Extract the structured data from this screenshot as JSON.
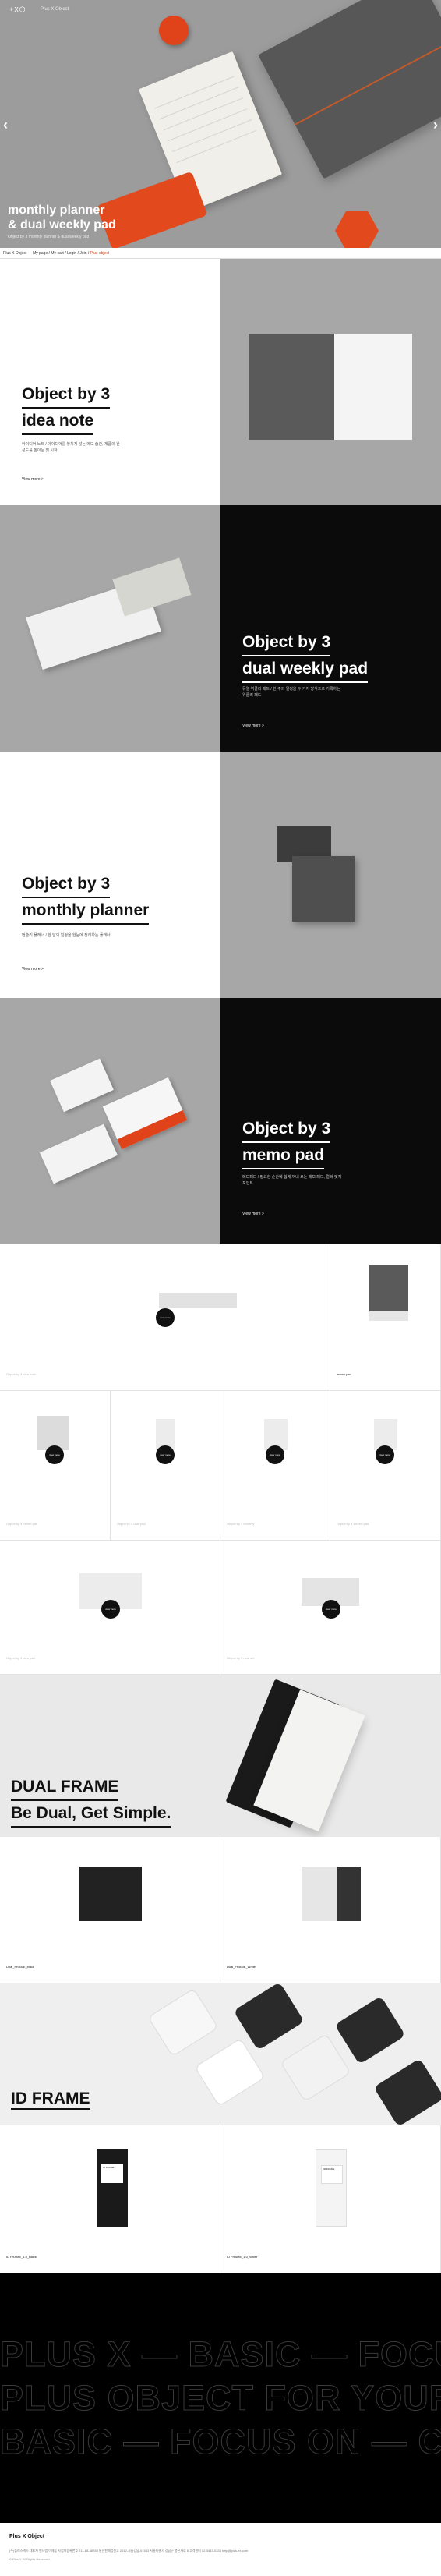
{
  "header": {
    "logo": "+X⬡",
    "brand": "Plus X Object",
    "hero_title_1": "monthly planner",
    "hero_title_2": "& dual weekly pad",
    "hero_sub": "Object by 3 monthly planner & dual weekly pad",
    "prev_arrow": "‹",
    "next_arrow": "›"
  },
  "breadcrumb": {
    "text": "Plus X Object — My page / My cart / Login / Join /",
    "highlight": "Plus object"
  },
  "products": [
    {
      "title_1": "Object by 3",
      "title_2": "idea note",
      "desc": "아이디어 노트 / 아이디어를 놓치지 않는 메모 습관, 제품의 완성도를 높이는 첫 시작",
      "more": "View more  >"
    },
    {
      "title_1": "Object by 3",
      "title_2": "dual weekly pad",
      "desc": "듀얼 위클리 패드 / 한 주의 일정을 두 가지 방식으로 기록하는 위클리 패드",
      "more": "View more  >"
    },
    {
      "title_1": "Object by 3",
      "title_2": "monthly planner",
      "desc": "먼슬리 플래너 / 한 달의 일정을 한눈에 정리하는 플래너",
      "more": "View more  >"
    },
    {
      "title_1": "Object by 3",
      "title_2": "memo pad",
      "desc": "메모패드 / 필요한 순간에 쉽게 꺼내 쓰는 메모 패드, 컬러 엣지 포인트",
      "more": "View more  >"
    }
  ],
  "gallery": {
    "item_label": "view more",
    "captions": [
      "Object by 3 idea note",
      "memo pad",
      "Object by 3 memo pad",
      "Object by 3 dual pad",
      "Object by 3 monthly",
      "Object by 3 weekly pad",
      "Object by 3 idea pad",
      "Object by 3 note set"
    ]
  },
  "dual_frame": {
    "title_1": "DUAL FRAME",
    "title_2": "Be Dual, Get Simple.",
    "products": [
      "Dual_FRAME_black",
      "Dual_FRAME_White"
    ]
  },
  "id_frame": {
    "title": "ID FRAME",
    "products": [
      "ID FRAME_1.0_Black",
      "ID FRAME_1.0_White"
    ],
    "label_text": "ID FRAME"
  },
  "banner": {
    "line1": "PLUS X — BASIC — FOCUS ON",
    "line2": "PLUS OBJECT FOR YOUR LIFE",
    "line3": "BASIC — FOCUS ON — CREAT"
  },
  "footer": {
    "brand": "Plus X Object",
    "info": "(주)플러스엑스   대표자 변사범 이재훈   사업자등록번호 211-88-48788   통신판매업신고 2012-서울강남-01543   서울특별시 강남구 봉은사로 8   고객센터 02-3443-0333   help@plus-ex.com",
    "copyright": "© Plus X All Rights Reserved."
  },
  "colors": {
    "accent": "#e24a1e",
    "dark": "#0b0b0b",
    "grey": "#a7a7a7"
  }
}
